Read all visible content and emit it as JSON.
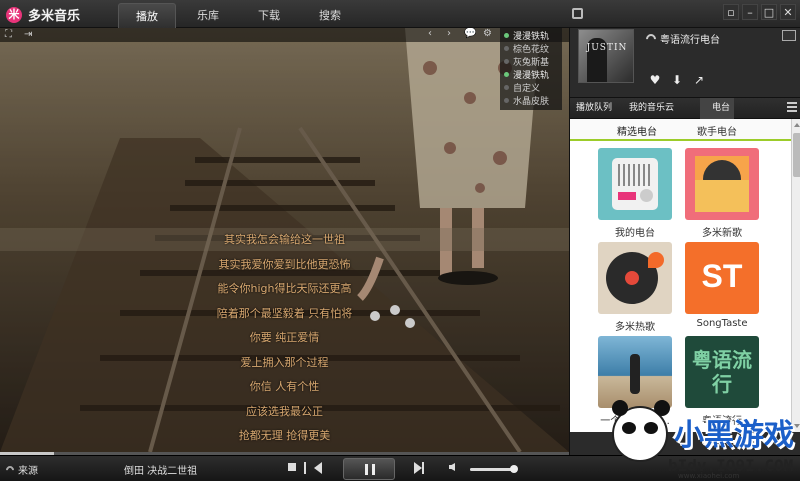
{
  "app": {
    "name": "多米音乐",
    "logo_char": "米"
  },
  "main_tabs": [
    {
      "label": "播放",
      "active": true
    },
    {
      "label": "乐库",
      "active": false
    },
    {
      "label": "下载",
      "active": false
    },
    {
      "label": "搜索",
      "active": false
    }
  ],
  "window_controls": {
    "minimize": "–",
    "maximize": "□",
    "close": "✕",
    "mini_mode": "▫"
  },
  "player_toolbar": {
    "left_icons": [
      "⛶",
      "⇥"
    ],
    "right_icons": [
      "‹",
      "›",
      "💬",
      "⚙"
    ]
  },
  "skins": {
    "current": "漫漫铁轨",
    "items": [
      {
        "label": "棕色花纹",
        "on": false
      },
      {
        "label": "灰兔斯基",
        "on": false
      },
      {
        "label": "漫漫铁轨",
        "on": true
      },
      {
        "label": "自定义",
        "on": false
      },
      {
        "label": "水晶皮肤",
        "on": false
      }
    ]
  },
  "lyrics": [
    "其实我怎会输给这一世祖",
    "其实我爱你爱到比他更恐怖",
    "能令你high得比天际还更高",
    "陪着那个最坚毅着 只有怕将",
    "你要 纯正爱情",
    "爱上拥入那个过程",
    "你信 人有个性",
    "应该选我最公正",
    "抢都无理 抢得更美"
  ],
  "progress_percent": 9,
  "now_playing": {
    "station": "粤语流行电台",
    "cover_text": "JUSTIN"
  },
  "actions": {
    "like": "♥",
    "download": "⬇",
    "share": "↗"
  },
  "sub_tabs": [
    {
      "label": "播放队列",
      "active": false
    },
    {
      "label": "我的音乐云",
      "active": false
    },
    {
      "label": "电台",
      "active": true
    }
  ],
  "radio_tabs": [
    {
      "label": "精选电台",
      "active": true
    },
    {
      "label": "歌手电台",
      "active": false
    }
  ],
  "radio_tiles": [
    {
      "label": "我的电台"
    },
    {
      "label": "多米新歌"
    },
    {
      "label": "多米热歌"
    },
    {
      "label": "SongTaste",
      "text": "ST"
    },
    {
      "label": "一个人整整个...",
      "text": ""
    },
    {
      "label": "粤语流行",
      "text": "粤语流行"
    }
  ],
  "control_bar": {
    "source_label": "来源",
    "song_text": "倒田  决战二世祖",
    "volume_percent": 95
  },
  "watermark": {
    "title": "小黑游戏",
    "url": "bIdv.IO9I.COM",
    "url2": "www.xiaohei.com"
  }
}
